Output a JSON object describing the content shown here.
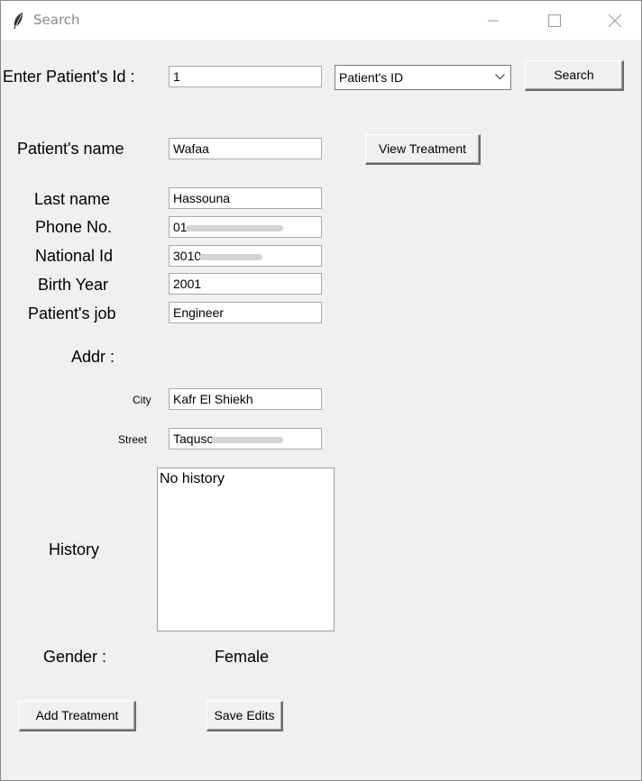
{
  "window": {
    "title": "Search",
    "icons": {
      "app": "feather-icon",
      "minimize": "minimize-icon",
      "maximize": "maximize-icon",
      "close": "close-icon"
    }
  },
  "search": {
    "id_label": "Enter Patient's Id :",
    "id_value": "1",
    "search_by_selected": "Patient's ID",
    "search_button": "Search"
  },
  "patient": {
    "name_label": "Patient's name",
    "name_value": "Wafaa",
    "view_treatment_button": "View Treatment",
    "last_name_label": "Last name",
    "last_name_value": "Hassouna",
    "phone_label": "Phone No.",
    "phone_value_visible": "01",
    "national_id_label": "National Id",
    "national_id_value_visible": "3010",
    "birth_year_label": "Birth Year",
    "birth_year_value": "2001",
    "job_label": "Patient's job",
    "job_value": "Engineer"
  },
  "address": {
    "label": "Addr :",
    "city_label": "City",
    "city_value": "Kafr El Shiekh",
    "street_label": "Street",
    "street_value_visible": "Taqusc"
  },
  "history": {
    "label": "History",
    "text": "No history"
  },
  "gender": {
    "label": "Gender :",
    "value": "Female"
  },
  "actions": {
    "add_treatment_button": "Add Treatment",
    "save_edits_button": "Save Edits"
  },
  "colors": {
    "window_bg": "#f0f0f0",
    "titlebar_bg": "#ffffff",
    "title_text": "#8a8a8a",
    "entry_border": "#a9a9a9"
  }
}
